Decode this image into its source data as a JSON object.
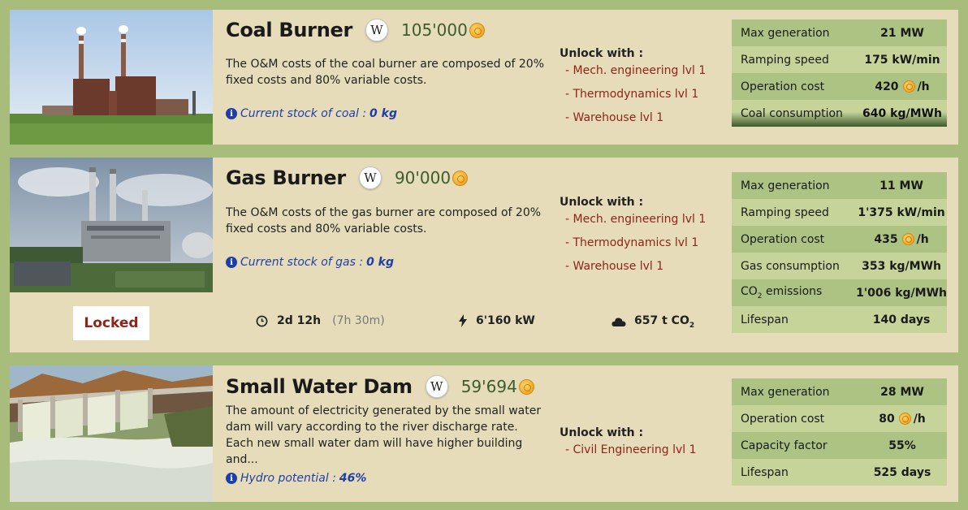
{
  "cards": [
    {
      "title": "Coal Burner",
      "wiki": "W",
      "price": "105'000",
      "description": "The O&M costs of the coal burner are composed of 20% fixed costs and 80% variable costs.",
      "stock_label": "Current stock of coal :",
      "stock_value": "0 kg",
      "unlock_title": "Unlock with :",
      "unlock_items": [
        "- Mech. engineering lvl 1",
        "- Thermodynamics lvl 1",
        "- Warehouse lvl 1"
      ],
      "stats": [
        {
          "label": "Max generation",
          "value": "21 MW"
        },
        {
          "label": "Ramping speed",
          "value": "175 kW/min"
        },
        {
          "label": "Operation cost",
          "value": "420",
          "unit": "/h"
        },
        {
          "label": "Coal consumption",
          "value": "640 kg/MWh"
        }
      ]
    },
    {
      "title": "Gas Burner",
      "wiki": "W",
      "price": "90'000",
      "description": "The O&M costs of the gas burner are composed of 20% fixed costs and 80% variable costs.",
      "stock_label": "Current stock of gas :",
      "stock_value": "0 kg",
      "unlock_title": "Unlock with :",
      "unlock_items": [
        "- Mech. engineering lvl 1",
        "- Thermodynamics lvl 1",
        "- Warehouse lvl 1"
      ],
      "stats": [
        {
          "label": "Max generation",
          "value": "11 MW"
        },
        {
          "label": "Ramping speed",
          "value": "1'375 kW/min"
        },
        {
          "label": "Operation cost",
          "value": "435",
          "unit": "/h"
        },
        {
          "label": "Gas consumption",
          "value": "353 kg/MWh"
        },
        {
          "label_pre": "CO",
          "label_sub": "2",
          "label_post": " emissions",
          "value": "1'006 kg/MWh"
        },
        {
          "label": "Lifespan",
          "value": "140 days"
        }
      ],
      "locked_label": "Locked",
      "build_time": "2d 12h",
      "build_time_extra": "(7h 30m)",
      "power": "6'160 kW",
      "co2_value": "657 t CO",
      "co2_sub": "2"
    },
    {
      "title": "Small Water Dam",
      "wiki": "W",
      "price": "59'694",
      "description": "The amount of electricity generated by the small water dam will vary according to the river discharge rate. Each new small water dam will have higher building and...",
      "stock_label": "Hydro potential :",
      "stock_value": "46%",
      "unlock_title": "Unlock with :",
      "unlock_items": [
        "- Civil Engineering lvl 1"
      ],
      "stats": [
        {
          "label": "Max generation",
          "value": "28 MW"
        },
        {
          "label": "Operation cost",
          "value": "80",
          "unit": "/h"
        },
        {
          "label": "Capacity factor",
          "value": "55%"
        },
        {
          "label": "Lifespan",
          "value": "525 days"
        }
      ]
    }
  ],
  "colors": {
    "background": "#a8bd7b",
    "card": "#e6dcba",
    "price": "#3d5c2e",
    "unlock": "#8f2419",
    "stock": "#1f3fa8",
    "stat_dark": "#acc383",
    "stat_light": "#c6d499"
  }
}
